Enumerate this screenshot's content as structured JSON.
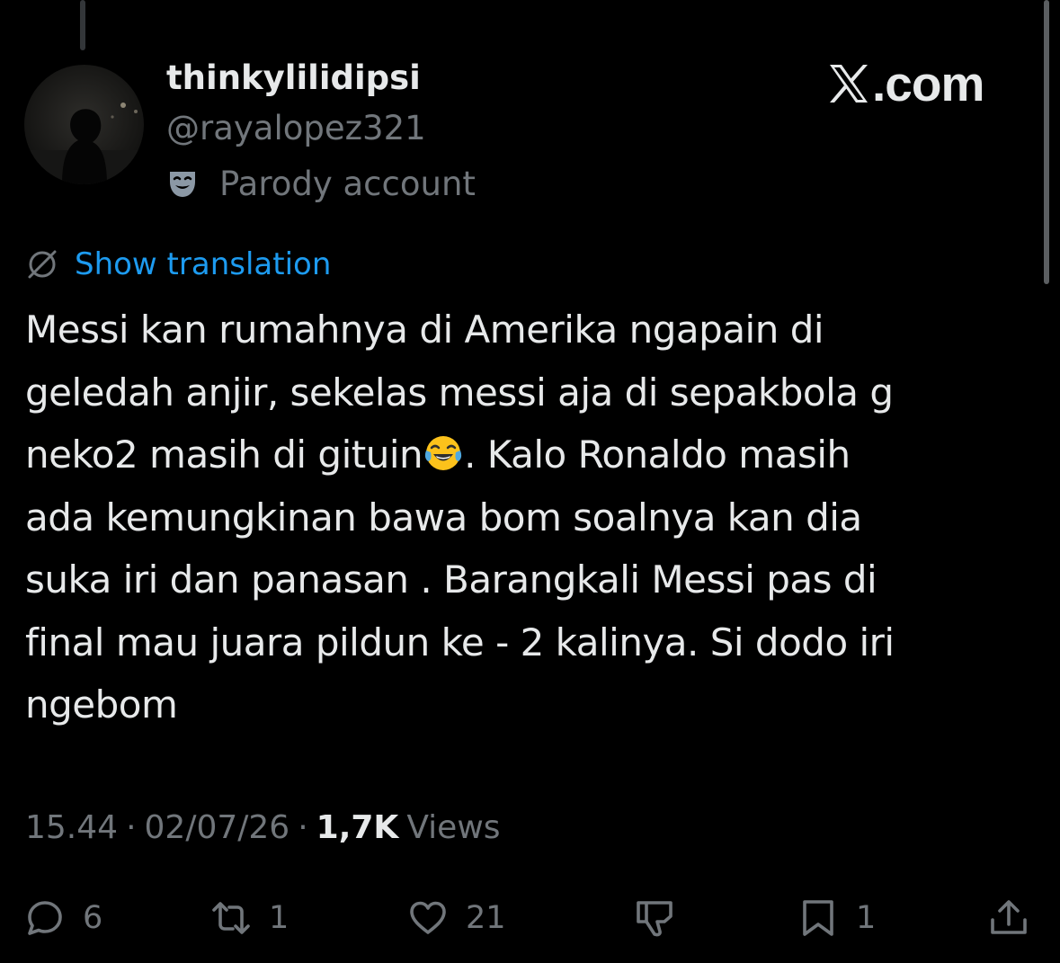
{
  "post": {
    "author": {
      "display_name": "thinkylilidipsi",
      "handle": "@rayalopez321",
      "badge_label": "Parody account",
      "badge_icon": "drama-mask-icon"
    },
    "brand_label": ".com",
    "brand_icon": "x-logo-icon",
    "translate_label": "Show translation",
    "translate_icon": "globe-icon",
    "text_lines": [
      "Messi kan rumahnya di Amerika ngapain di",
      "geledah anjir, sekelas messi aja di sepakbola g",
      "neko2 masih di gituin",
      ". Kalo Ronaldo masih",
      "ada kemungkinan bawa bom soalnya kan dia",
      "suka iri dan panasan . Barangkali Messi pas di",
      "final mau juara pildun ke - 2 kalinya. Si dodo iri",
      "ngebom"
    ],
    "emoji": "tears-of-joy-emoji",
    "meta": {
      "time": "15.44",
      "separator": "·",
      "date": "02/07/26",
      "views_count": "1,7K",
      "views_label": "Views"
    },
    "actions": {
      "reply": {
        "icon": "reply-icon",
        "count": "6"
      },
      "repost": {
        "icon": "repost-icon",
        "count": "1"
      },
      "like": {
        "icon": "heart-icon",
        "count": "21"
      },
      "downvote": {
        "icon": "downvote-icon",
        "count": ""
      },
      "bookmark": {
        "icon": "bookmark-icon",
        "count": "1"
      },
      "share": {
        "icon": "share-icon",
        "count": ""
      }
    }
  },
  "colors": {
    "background": "#000000",
    "primary_text": "#e7e9ea",
    "secondary_text": "#71767b",
    "link": "#1d9bf0"
  }
}
